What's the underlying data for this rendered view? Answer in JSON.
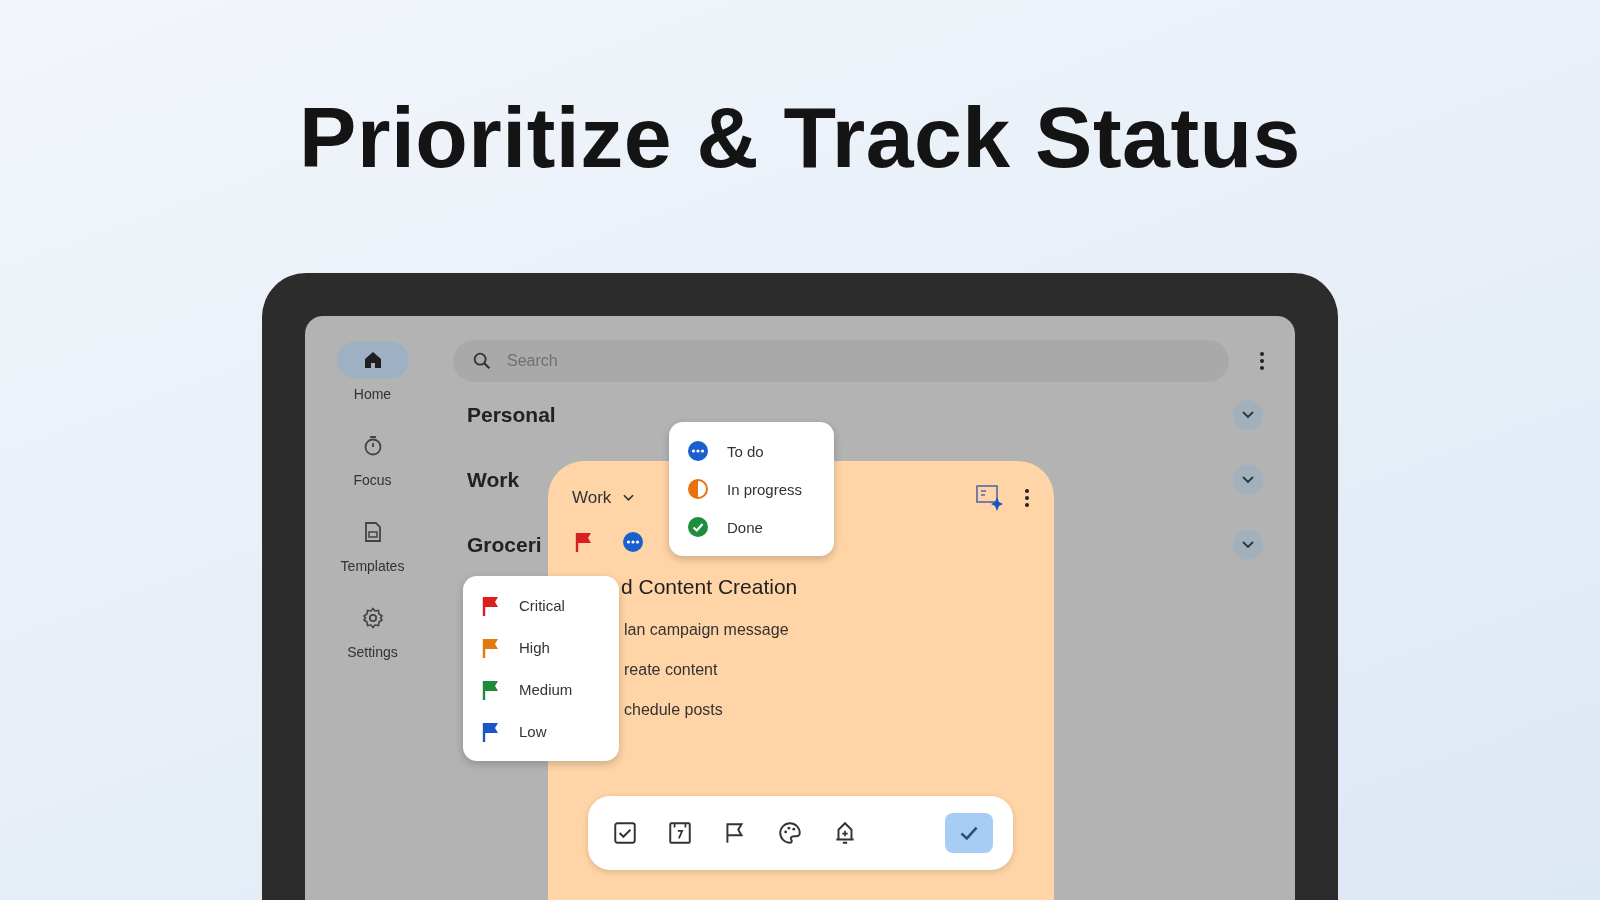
{
  "headline": "Prioritize & Track Status",
  "nav": [
    {
      "label": "Home",
      "selected": true
    },
    {
      "label": "Focus",
      "selected": false
    },
    {
      "label": "Templates",
      "selected": false
    },
    {
      "label": "Settings",
      "selected": false
    }
  ],
  "search": {
    "placeholder": "Search"
  },
  "sections": [
    {
      "title": "Personal"
    },
    {
      "title": "Work"
    },
    {
      "title": "Groceri"
    }
  ],
  "note": {
    "category": "Work",
    "badges": [
      {
        "kind": "flag",
        "color": "#d91f1f"
      },
      {
        "kind": "todo",
        "color": "#1a5fd0"
      }
    ],
    "title": "d Content Creation",
    "items": [
      "lan campaign message",
      "reate content",
      "chedule posts"
    ]
  },
  "status_menu": [
    {
      "label": "To do",
      "kind": "todo",
      "color": "#1a5fd0"
    },
    {
      "label": "In progress",
      "kind": "progress",
      "color": "#e8710a"
    },
    {
      "label": "Done",
      "kind": "done",
      "color": "#1e8e3e"
    }
  ],
  "priority_menu": [
    {
      "label": "Critical",
      "color": "#d91f1f"
    },
    {
      "label": "High",
      "color": "#e07b10"
    },
    {
      "label": "Medium",
      "color": "#1e8a3a"
    },
    {
      "label": "Low",
      "color": "#1a56c4"
    }
  ]
}
